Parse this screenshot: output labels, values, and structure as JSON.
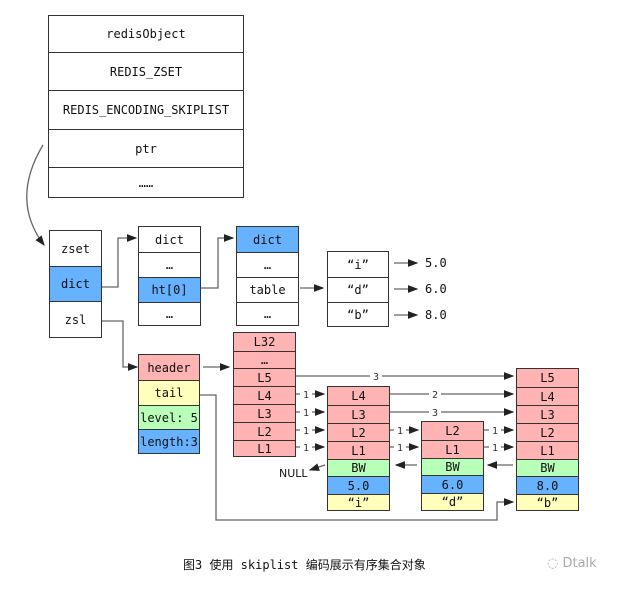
{
  "redis_object": {
    "rows": [
      "redisObject",
      "REDIS_ZSET",
      "REDIS_ENCODING_SKIPLIST",
      "ptr",
      "……"
    ]
  },
  "zset": {
    "rows": [
      "zset",
      "dict",
      "zsl"
    ]
  },
  "dict_struct": {
    "rows": [
      "dict",
      "…",
      "ht[0]",
      "…"
    ]
  },
  "dictht": {
    "rows": [
      "dict",
      "…",
      "table",
      "…"
    ]
  },
  "dict_entries": {
    "keys": [
      "“i”",
      "“d”",
      "“b”"
    ],
    "values": [
      "5.0",
      "6.0",
      "8.0"
    ]
  },
  "zskiplist": {
    "rows": [
      "header",
      "tail",
      "level: 5",
      "length:3"
    ]
  },
  "header_node": {
    "levels": [
      "L32",
      "…",
      "L5",
      "L4",
      "L3",
      "L2",
      "L1"
    ]
  },
  "node_i": {
    "levels": [
      "L4",
      "L3",
      "L2",
      "L1"
    ],
    "backward": "BW",
    "score": "5.0",
    "obj": "“i”"
  },
  "node_d": {
    "levels": [
      "L2",
      "L1"
    ],
    "backward": "BW",
    "score": "6.0",
    "obj": "“d”"
  },
  "node_b": {
    "levels": [
      "L5",
      "L4",
      "L3",
      "L2",
      "L1"
    ],
    "backward": "BW",
    "score": "8.0",
    "obj": "“b”"
  },
  "spans": {
    "header_L5": "3",
    "header_L4": "1",
    "header_L3": "1",
    "header_L2": "1",
    "header_L1": "1",
    "i_L4": "2",
    "i_L3": "3",
    "i_L2": "1",
    "i_L1": "1",
    "d_L2": "1",
    "d_L1": "1"
  },
  "null_label": "NULL",
  "caption": "图3 使用 skiplist 编码展示有序集合对象",
  "watermark": "Dtalk",
  "colors": {
    "level": "#ffb3b3",
    "obj": "#ffffbb",
    "backward": "#b8ffb8",
    "score": "#66b2ff"
  }
}
